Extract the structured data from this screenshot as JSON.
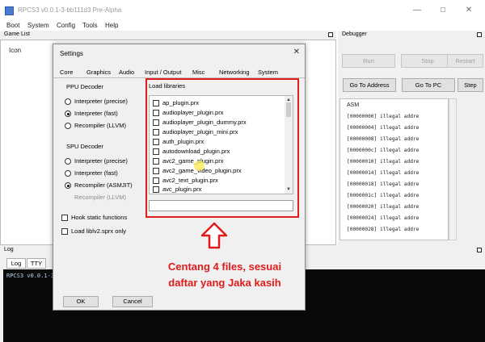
{
  "window": {
    "title": "RPCS3 v0.0.1-3-bb111d3 Pre-Alpha",
    "controls": [
      "minimize",
      "maximize",
      "close"
    ]
  },
  "menu": [
    "Boot",
    "System",
    "Config",
    "Tools",
    "Help"
  ],
  "game_list": {
    "title": "Game List",
    "column": "Icon"
  },
  "debugger": {
    "title": "Debugger",
    "buttons": {
      "run": "Run",
      "stop": "Stop",
      "restart": "Restart",
      "go_address": "Go To Address",
      "go_pc": "Go To PC",
      "step": "Step"
    },
    "asm_label": "ASM",
    "asm_rows": [
      "[00000000] illegal addre",
      "[00000004] illegal addre",
      "[00000008] illegal addre",
      "[0000000c] illegal addre",
      "[00000010] illegal addre",
      "[00000014] illegal addre",
      "[00000018] illegal addre",
      "[0000001c] illegal addre",
      "[00000020] illegal addre",
      "[00000024] illegal addre",
      "[00000028] illegal addre"
    ]
  },
  "log": {
    "title": "Log",
    "tabs": [
      "Log",
      "TTY"
    ],
    "first_line": "RPCS3 v0.0.1-3-"
  },
  "settings": {
    "title": "Settings",
    "tabs": [
      "Core",
      "Graphics",
      "Audio",
      "Input / Output",
      "Misc",
      "Networking",
      "System"
    ],
    "ppu": {
      "title": "PPU Decoder",
      "options": [
        "Interpreter (precise)",
        "Interpreter (fast)",
        "Recompiler (LLVM)"
      ],
      "selected": "Interpreter (fast)"
    },
    "spu": {
      "title": "SPU Decoder",
      "options": [
        "Interpreter (precise)",
        "Interpreter (fast)",
        "Recompiler (ASMJIT)",
        "Recompiler (LLVM)"
      ],
      "selected": "Recompiler (ASMJIT)"
    },
    "checks": [
      "Hook static functions",
      "Load liblv2.sprx only"
    ],
    "libraries": {
      "title": "Load libraries",
      "items": [
        "ap_plugin.prx",
        "audioplayer_plugin.prx",
        "audioplayer_plugin_dummy.prx",
        "audioplayer_plugin_mini.prx",
        "auth_plugin.prx",
        "autodownload_plugin.prx",
        "avc2_game_plugin.prx",
        "avc2_game_video_plugin.prx",
        "avc2_text_plugin.prx",
        "avc_plugin.prx"
      ],
      "search_value": ""
    },
    "ok": "OK",
    "cancel": "Cancel"
  },
  "annotation": {
    "line1": "Centang 4 files, sesuai",
    "line2": "daftar yang Jaka kasih",
    "color": "#e01b1b"
  }
}
